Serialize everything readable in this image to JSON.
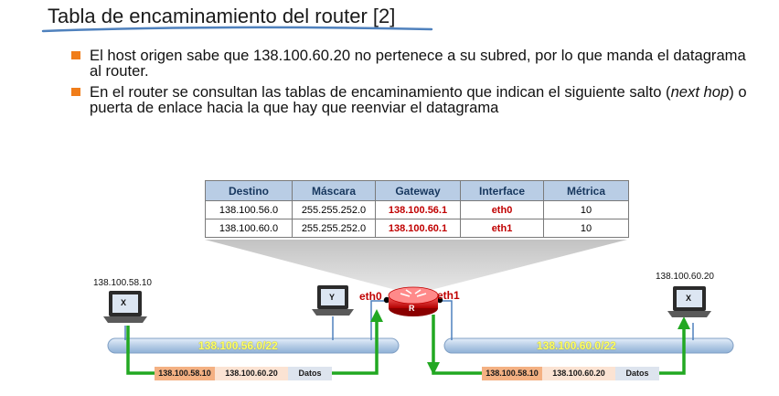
{
  "title": "Tabla de encaminamiento del router [2]",
  "bullets": [
    {
      "text": "El host origen sabe  que 138.100.60.20 no pertenece a su subred, por lo que manda el datagrama al router."
    },
    {
      "text_before": "En el router se consultan las tablas de encaminamiento que indican el siguiente salto (",
      "text_italic": "next hop",
      "text_after": ") o puerta de enlace hacia la que hay que reenviar el datagrama"
    }
  ],
  "routing_table": {
    "headers": [
      "Destino",
      "Máscara",
      "Gateway",
      "Interface",
      "Métrica"
    ],
    "rows": [
      [
        "138.100.56.0",
        "255.255.252.0",
        "138.100.56.1",
        "eth0",
        "10"
      ],
      [
        "138.100.60.0",
        "255.255.252.0",
        "138.100.60.1",
        "eth1",
        "10"
      ]
    ]
  },
  "hosts": {
    "left": {
      "ip": "138.100.58.10",
      "screen_label": "X"
    },
    "middle": {
      "screen_label": "Y"
    },
    "right": {
      "ip": "138.100.60.20",
      "screen_label": "X"
    }
  },
  "router": {
    "label": "R",
    "if_left": "eth0",
    "if_right": "eth1"
  },
  "networks": {
    "left": "138.100.56.0/22",
    "right": "138.100.60.0/22"
  },
  "packets": {
    "left": {
      "src": "138.100.58.10",
      "dst": "138.100.60.20",
      "payload": "Datos"
    },
    "right": {
      "src": "138.100.58.10",
      "dst": "138.100.60.20",
      "payload": "Datos"
    }
  },
  "colors": {
    "bullet": "#f07d1a",
    "header_bg": "#b9cde5",
    "gateway_red": "#c00000",
    "path_green": "#22a822",
    "bus_blue": "#c6d9f1"
  }
}
